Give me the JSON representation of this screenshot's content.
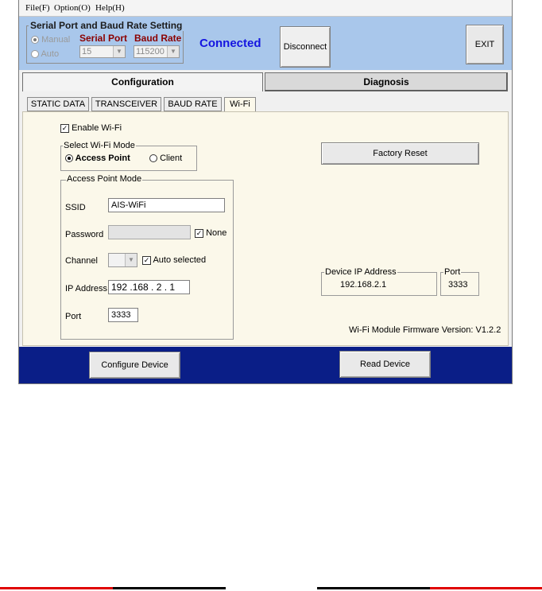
{
  "menu": {
    "file": "File(F)",
    "option": "Option(O)",
    "help": "Help(H)"
  },
  "serial": {
    "group_title": "Serial Port and Baud Rate Setting",
    "manual": "Manual",
    "auto": "Auto",
    "serial_port_label": "Serial Port",
    "baud_rate_label": "Baud Rate",
    "serial_port_value": "15",
    "baud_rate_value": "115200"
  },
  "status": "Connected",
  "disconnect_label": "Disconnect",
  "exit_label": "EXIT",
  "main_tabs": {
    "configuration": "Configuration",
    "diagnosis": "Diagnosis"
  },
  "sub_tabs": {
    "static": "STATIC DATA",
    "transceiver": "TRANSCEIVER",
    "baud": "BAUD RATE",
    "wifi": "Wi-Fi"
  },
  "wifi": {
    "enable_label": "Enable Wi-Fi",
    "mode_group": "Select Wi-Fi Mode",
    "access_point": "Access Point",
    "client": "Client",
    "ap_group": "Access Point Mode",
    "ssid_label": "SSID",
    "ssid_value": "AIS-WiFi",
    "password_label": "Password",
    "none_label": "None",
    "channel_label": "Channel",
    "auto_selected_label": "Auto selected",
    "ip_label": "IP Address",
    "ip_value": "192 .168 .  2  .  1",
    "port_label": "Port",
    "port_value": "3333"
  },
  "factory_reset_label": "Factory Reset",
  "device_ip": {
    "label": "Device IP Address",
    "value": "192.168.2.1"
  },
  "device_port": {
    "label": "Port",
    "value": "3333"
  },
  "firmware_text": "Wi-Fi Module Firmware Version: V1.2.2",
  "configure_device_label": "Configure Device",
  "read_device_label": "Read Device",
  "colors": {
    "accent_blue": "#1515e0",
    "dark_red": "#8b0000",
    "top_band": "#a9c7eb",
    "bottom_band": "#0a1e87",
    "panel": "#fbf8ea"
  }
}
